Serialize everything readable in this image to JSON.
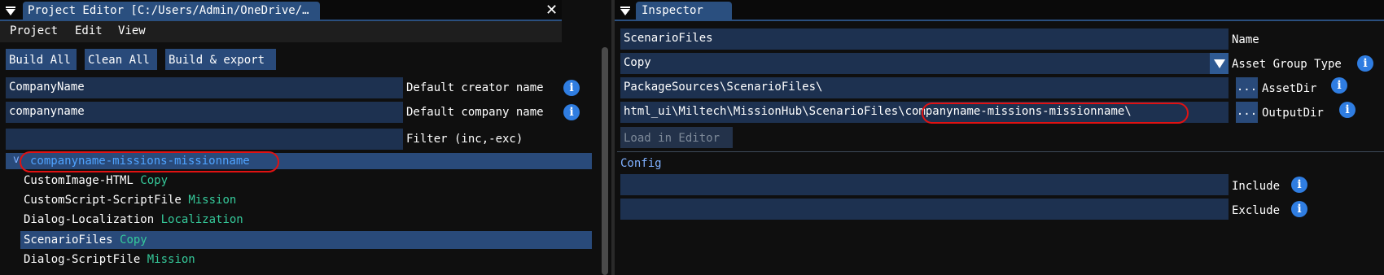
{
  "left_panel": {
    "title": "Project Editor [C:/Users/Admin/OneDrive/…",
    "close_glyph": "✕",
    "menu": [
      "Project",
      "Edit",
      "View"
    ],
    "buttons": [
      "Build All",
      "Clean All",
      "Build & export"
    ],
    "creator_field": {
      "value": "CompanyName",
      "label": "Default creator name"
    },
    "company_field": {
      "value": "companyname",
      "label": "Default company name"
    },
    "filter_field": {
      "value": "",
      "label": "Filter (inc,-exc)"
    },
    "tree": {
      "root": "companyname-missions-missionname",
      "root_arrow": "v",
      "items": [
        {
          "name": "CustomImage-HTML",
          "type": "Copy"
        },
        {
          "name": "CustomScript-ScriptFile",
          "type": "Mission"
        },
        {
          "name": "Dialog-Localization",
          "type": "Localization"
        },
        {
          "name": "ScenarioFiles",
          "type": "Copy"
        },
        {
          "name": "Dialog-ScriptFile",
          "type": "Mission"
        }
      ]
    }
  },
  "inspector": {
    "title": "Inspector",
    "name_field": {
      "value": "ScenarioFiles",
      "label": "Name"
    },
    "asset_group_type": {
      "value": "Copy",
      "label": "Asset Group Type"
    },
    "asset_dir": {
      "value": "PackageSources\\ScenarioFiles\\",
      "browse": "...",
      "label": "AssetDir"
    },
    "output_dir": {
      "prefix": "html_ui\\Miltech\\MissionHub\\ScenarioFiles",
      "highlight": "\\companyname-missions-missionname\\",
      "browse": "...",
      "label": "OutputDir"
    },
    "load_button": "Load in Editor",
    "config_header": "Config",
    "include": {
      "value": "",
      "label": "Include"
    },
    "exclude": {
      "value": "",
      "label": "Exclude"
    }
  },
  "icons": {
    "info": "i",
    "dropdown": "▼"
  },
  "colors": {
    "accent": "#2a4f7f",
    "teal": "#35c99a",
    "info_blue": "#2f7de1",
    "highlight_red": "#e01212"
  }
}
